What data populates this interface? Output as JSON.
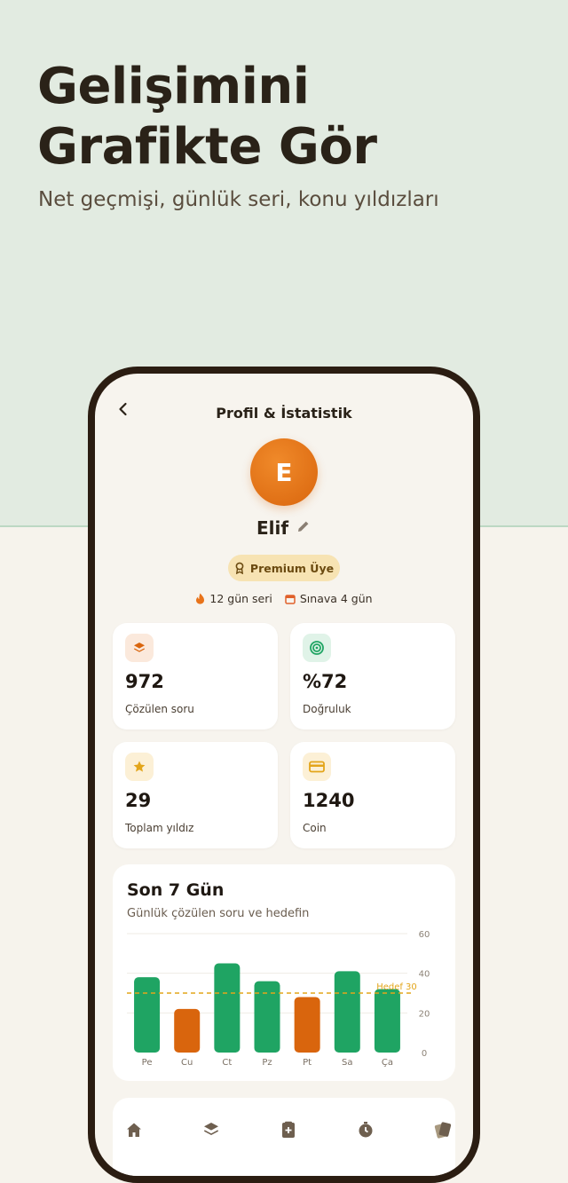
{
  "hero": {
    "title_line1": "Gelişimini",
    "title_line2": "Grafikte Gör",
    "subtitle": "Net geçmişi, günlük seri, konu yıldızları"
  },
  "screen": {
    "title": "Profil & İstatistik",
    "back_icon": "chevron-left-icon"
  },
  "profile": {
    "avatar_letter": "E",
    "name": "Elif",
    "premium_label": "Premium Üye",
    "streak": "12 gün seri",
    "exam": "Sınava 4 gün"
  },
  "stats": [
    {
      "icon": "layers-icon",
      "value": "972",
      "label": "Çözülen soru",
      "color": "#d9650d",
      "bg": "#fbe9dc"
    },
    {
      "icon": "target-icon",
      "value": "%72",
      "label": "Doğruluk",
      "color": "#1fa463",
      "bg": "#e0f3e8"
    },
    {
      "icon": "star-icon",
      "value": "29",
      "label": "Toplam yıldız",
      "color": "#e3a51a",
      "bg": "#fcf0d6"
    },
    {
      "icon": "card-icon",
      "value": "1240",
      "label": "Coin",
      "color": "#e3a51a",
      "bg": "#fcf0d6"
    }
  ],
  "chart_section": {
    "title": "Son 7 Gün",
    "subtitle": "Günlük çözülen soru ve hedefin"
  },
  "chart_data": {
    "type": "bar",
    "categories": [
      "Pe",
      "Cu",
      "Ct",
      "Pz",
      "Pt",
      "Sa",
      "Ça"
    ],
    "values": [
      38,
      22,
      45,
      36,
      28,
      41,
      32
    ],
    "colors": [
      "#1fa463",
      "#d9650d",
      "#1fa463",
      "#1fa463",
      "#d9650d",
      "#1fa463",
      "#1fa463"
    ],
    "ylim": [
      0,
      60
    ],
    "yticks": [
      0,
      20,
      40,
      60
    ],
    "target": 30,
    "target_label": "Hedef 30",
    "grid": true
  },
  "nav": [
    "home-icon",
    "layers-icon",
    "notebook-icon",
    "timer-icon",
    "cards-icon"
  ],
  "colors": {
    "accent": "#d9650d",
    "success": "#1fa463",
    "gold": "#e3a51a",
    "dark": "#2a2218"
  }
}
